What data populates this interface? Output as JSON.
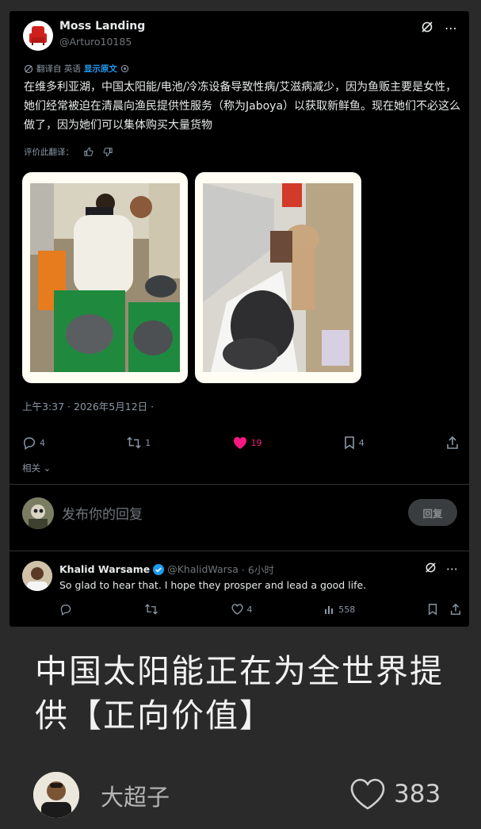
{
  "tweet": {
    "author_name": "Moss Landing",
    "author_handle": "@Arturo10185",
    "translate_prefix": "翻译自 英语",
    "translate_link": "显示原文",
    "body": "在维多利亚湖，中国太阳能/电池/冷冻设备导致性病/艾滋病减少，因为鱼贩主要是女性，她们经常被迫在清晨向渔民提供性服务（称为Jaboya）以获取新鲜鱼。现在她们不必这么做了，因为她们可以集体购买大量货物",
    "rate_label": "评价此翻译：",
    "timestamp": "上午3:37 · 2026年5月12日 ·",
    "replies": "4",
    "retweets": "1",
    "likes": "19",
    "bookmarks": "4",
    "related": "相关",
    "reply_placeholder": "发布你的回复",
    "reply_button": "回复"
  },
  "comment": {
    "name": "Khalid Warsame",
    "handle": "@KhalidWarsa",
    "time": "· 6小时",
    "text": "So glad to hear that. I hope they prosper and lead a good life.",
    "likes": "4",
    "views": "558"
  },
  "post": {
    "caption": "中国太阳能正在为全世界提供【正向价值】",
    "poster_name": "大超子",
    "like_count": "383"
  },
  "colors": {
    "accent": "#1d9bf0",
    "like": "#f91880",
    "background": "#000000",
    "card": "#2a2a2a"
  }
}
